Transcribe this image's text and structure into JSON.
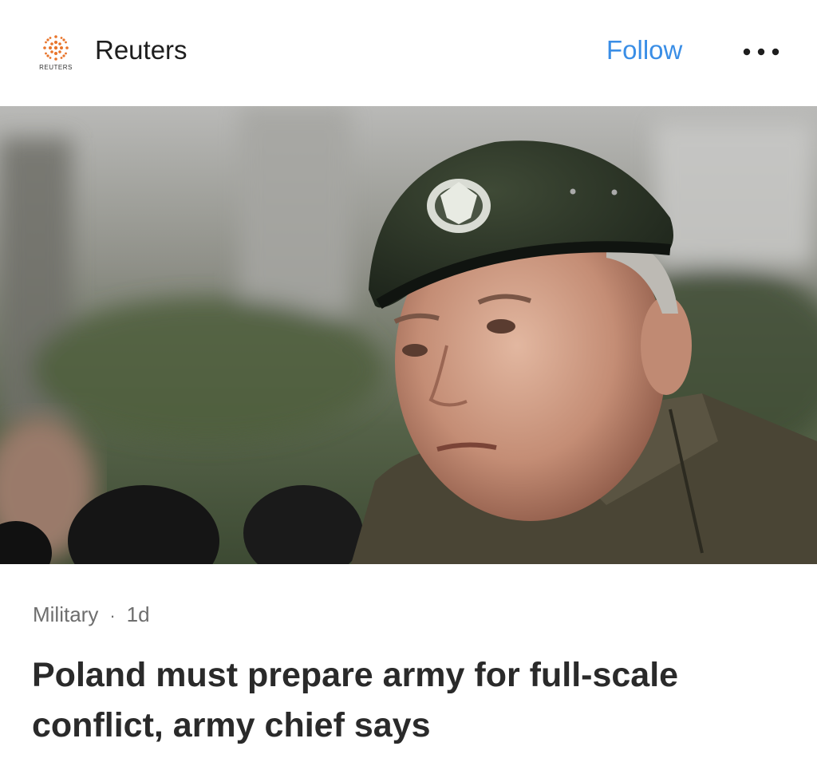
{
  "header": {
    "logo_icon": "reuters-logo-icon",
    "logo_text": "REUTERS",
    "publisher_name": "Reuters",
    "follow_label": "Follow",
    "more_icon": "more-horizontal-icon"
  },
  "article": {
    "category": "Military",
    "separator": "·",
    "age": "1d",
    "headline": "Poland must prepare army for full-scale conflict, army chief says"
  },
  "colors": {
    "accent": "#3a8ee6",
    "logo_orange": "#e8742a",
    "headline": "#2a2a2a",
    "meta": "#6e6e6e"
  }
}
